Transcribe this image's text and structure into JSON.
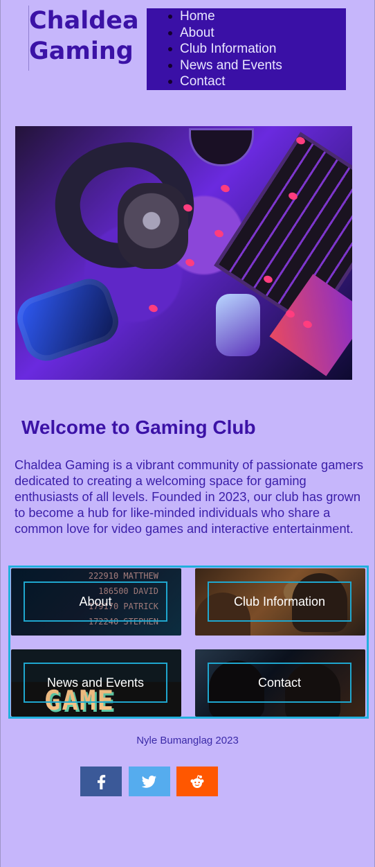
{
  "header": {
    "brand_line1": "Chaldea",
    "brand_line2": "Gaming",
    "nav": [
      {
        "label": "Home"
      },
      {
        "label": "About"
      },
      {
        "label": "Club Information"
      },
      {
        "label": "News and Events"
      },
      {
        "label": "Contact"
      }
    ]
  },
  "hero": {
    "image_icon": "gaming-setup-image"
  },
  "main": {
    "title": "Welcome to Gaming Club",
    "description": "Chaldea Gaming is a vibrant community of passionate gamers dedicated to creating a welcoming space for gaming enthusiasts of all levels. Founded in 2023, our club has grown to become a hub for like-minded individuals who share a common love for video games and interactive entertainment."
  },
  "cards": {
    "items": [
      {
        "label": "About",
        "image": "arcade-leaderboard-image",
        "scoreboard": [
          "222910 MATTHEW",
          "186500 DAVID",
          "179170 PATRICK",
          "172240 STEPHEN"
        ]
      },
      {
        "label": "Club Information",
        "image": "players-with-controllers-image"
      },
      {
        "label": "News and Events",
        "image": "game-sign-image",
        "sign_text": "GAME"
      },
      {
        "label": "Contact",
        "image": "players-at-monitors-image"
      }
    ]
  },
  "footer": {
    "credit": "Nyle Bumanglag 2023",
    "social": [
      {
        "icon": "facebook-icon",
        "color": "#3b5998"
      },
      {
        "icon": "twitter-icon",
        "color": "#55acee"
      },
      {
        "icon": "reddit-icon",
        "color": "#ff5700"
      }
    ]
  },
  "colors": {
    "page_background": "#c6b6fb",
    "brand": "#3b12a6",
    "nav_background": "#3a10a6",
    "nav_text": "#e9e6ff",
    "accent_border": "#21b0dd"
  }
}
